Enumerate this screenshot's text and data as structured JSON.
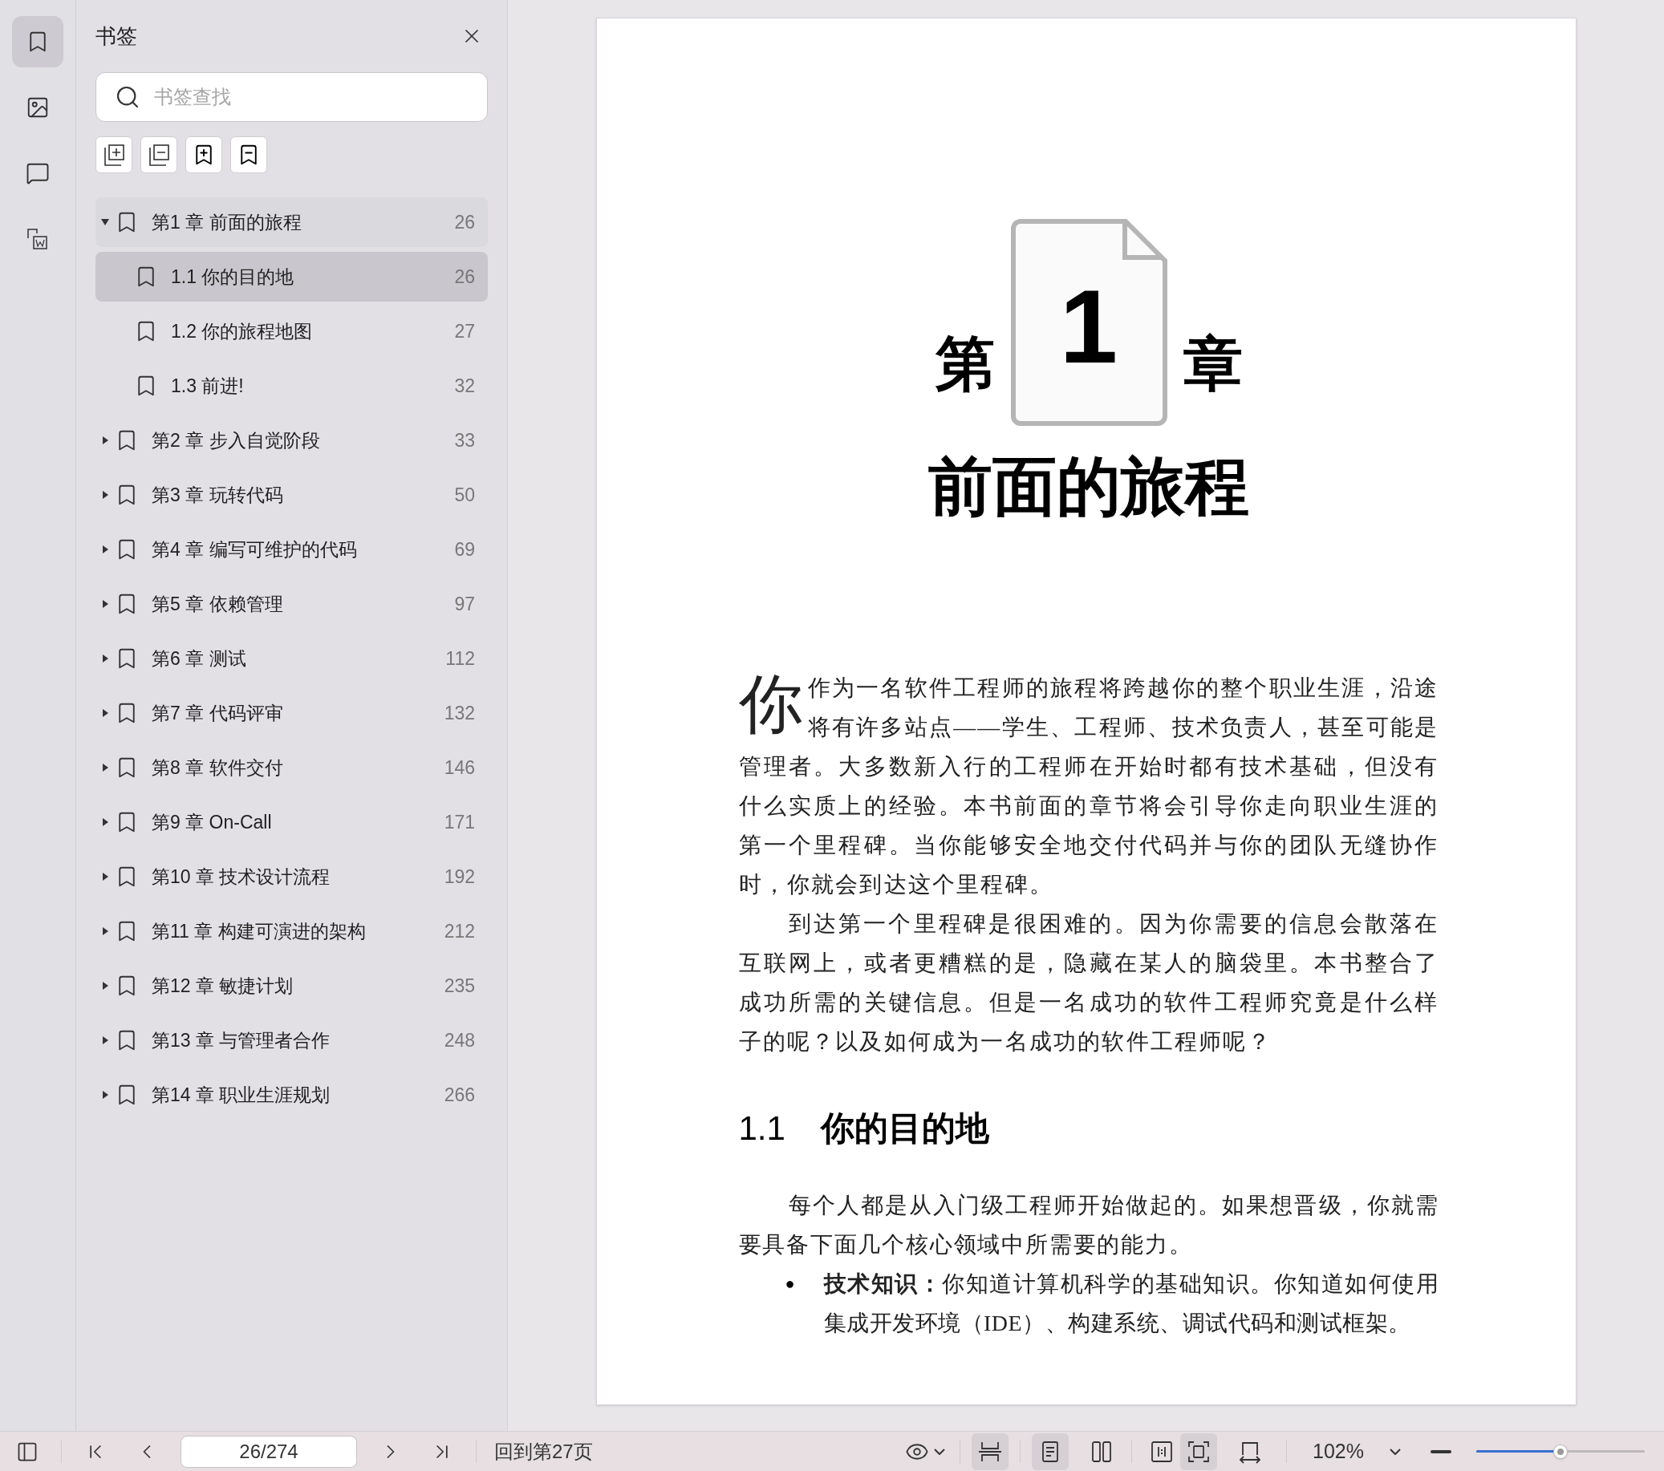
{
  "rail": [
    {
      "kind": "bookmark",
      "selected": true
    },
    {
      "kind": "image",
      "selected": false
    },
    {
      "kind": "comment",
      "selected": false
    },
    {
      "kind": "convert",
      "selected": false
    }
  ],
  "sidebar": {
    "title": "书签",
    "search": {
      "placeholder": "书签查找"
    },
    "tools": [
      {
        "kind": "expand-all"
      },
      {
        "kind": "collapse-all"
      },
      {
        "kind": "add"
      },
      {
        "kind": "remove"
      }
    ],
    "items": [
      {
        "label": "第1 章 前面的旅程",
        "page": "26",
        "expanded": true,
        "selected": false,
        "children": [
          {
            "label": "1.1 你的目的地",
            "page": "26",
            "selected": true
          },
          {
            "label": "1.2 你的旅程地图",
            "page": "27",
            "selected": false
          },
          {
            "label": "1.3 前进!",
            "page": "32",
            "selected": false
          }
        ]
      },
      {
        "label": "第2 章 步入自觉阶段",
        "page": "33",
        "expanded": false,
        "selected": false
      },
      {
        "label": "第3 章 玩转代码",
        "page": "50",
        "expanded": false,
        "selected": false
      },
      {
        "label": "第4 章 编写可维护的代码",
        "page": "69",
        "expanded": false,
        "selected": false
      },
      {
        "label": "第5 章 依赖管理",
        "page": "97",
        "expanded": false,
        "selected": false
      },
      {
        "label": "第6 章 测试",
        "page": "112",
        "expanded": false,
        "selected": false
      },
      {
        "label": "第7 章 代码评审",
        "page": "132",
        "expanded": false,
        "selected": false
      },
      {
        "label": "第8 章 软件交付",
        "page": "146",
        "expanded": false,
        "selected": false
      },
      {
        "label": "第9 章 On-Call",
        "page": "171",
        "expanded": false,
        "selected": false
      },
      {
        "label": "第10 章 技术设计流程",
        "page": "192",
        "expanded": false,
        "selected": false
      },
      {
        "label": "第11 章 构建可演进的架构",
        "page": "212",
        "expanded": false,
        "selected": false
      },
      {
        "label": "第12 章 敏捷计划",
        "page": "235",
        "expanded": false,
        "selected": false
      },
      {
        "label": "第13 章 与管理者合作",
        "page": "248",
        "expanded": false,
        "selected": false
      },
      {
        "label": "第14 章 职业生涯规划",
        "page": "266",
        "expanded": false,
        "selected": false
      }
    ]
  },
  "page": {
    "chapter_prefix": "第",
    "chapter_number": "1",
    "chapter_suffix": "章",
    "chapter_title": "前面的旅程",
    "drop_cap": "你",
    "paragraphs": [
      "作为一名软件工程师的旅程将跨越你的整个职业生涯，沿途将有许多站点——学生、工程师、技术负责人，甚至可能是管理者。大多数新入行的工程师在开始时都有技术基础，但没有什么实质上的经验。本书前面的章节将会引导你走向职业生涯的第一个里程碑。当你能够安全地交付代码并与你的团队无缝协作时，你就会到达这个里程碑。",
      "到达第一个里程碑是很困难的。因为你需要的信息会散落在互联网上，或者更糟糕的是，隐藏在某人的脑袋里。本书整合了成功所需的关键信息。但是一名成功的软件工程师究竟是什么样子的呢？以及如何成为一名成功的软件工程师呢？"
    ],
    "section_number": "1.1",
    "section_title": "你的目的地",
    "section_text": "每个人都是从入门级工程师开始做起的。如果想晋级，你就需要具备下面几个核心领域中所需要的能力。",
    "bullets": [
      {
        "mark": "●",
        "text": "**技术知识：**你知道计算机科学的基础知识。你知道如何使用集成开发环境（IDE）、构建系统、调试代码和测试框架。"
      }
    ]
  },
  "status_bar": {
    "page_field": "26/274",
    "goto": "回到第27页",
    "views": [
      {
        "kind": "continuous",
        "selected": true
      },
      {
        "kind": "single",
        "selected": true
      },
      {
        "kind": "double",
        "selected": false
      },
      {
        "kind": "fit-width",
        "selected": false
      },
      {
        "kind": "fit-page",
        "selected": true
      },
      {
        "kind": "rotate",
        "selected": false
      }
    ],
    "zoom": "102%",
    "zoom_slider": {
      "level": 0.5
    }
  }
}
